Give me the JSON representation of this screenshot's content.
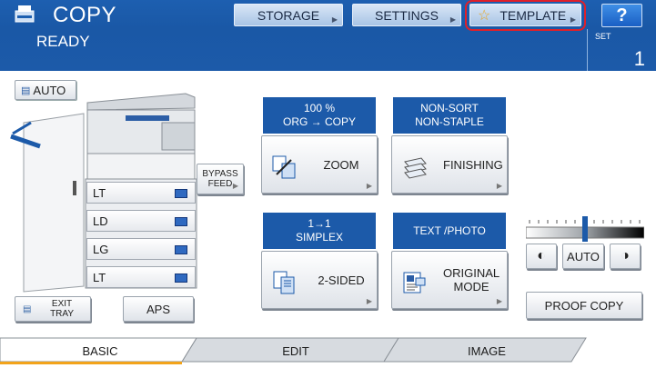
{
  "header": {
    "title": "COPY",
    "status": "READY",
    "buttons": {
      "storage": "STORAGE",
      "settings": "SETTINGS",
      "template": "TEMPLATE",
      "help": "?"
    },
    "set": {
      "label": "SET",
      "value": "1"
    },
    "icons": {
      "app": "copier-icon",
      "template": "star-icon"
    }
  },
  "left": {
    "auto_label": "AUTO",
    "trays": [
      "LT",
      "LD",
      "LG",
      "LT"
    ],
    "bypass_feed": [
      "BYPASS",
      "FEED"
    ],
    "exit_tray": [
      "EXIT",
      "TRAY"
    ],
    "aps": "APS"
  },
  "functions": {
    "zoom": {
      "header": [
        "100 %",
        "ORG → COPY"
      ],
      "label": "ZOOM",
      "icon": "zoom-icon"
    },
    "finishing": {
      "header": [
        "NON-SORT",
        "NON-STAPLE"
      ],
      "label": "FINISHING",
      "icon": "finishing-icon"
    },
    "two_sided": {
      "header": [
        "1→1",
        "SIMPLEX"
      ],
      "label": "2-SIDED",
      "icon": "duplex-icon"
    },
    "original_mode": {
      "header": [
        "TEXT /PHOTO"
      ],
      "label": [
        "ORIGINAL",
        "MODE"
      ],
      "icon": "original-mode-icon"
    }
  },
  "density": {
    "auto_label": "AUTO",
    "level_fraction": 0.5
  },
  "proof_copy": "PROOF COPY",
  "tabs": [
    "BASIC",
    "EDIT",
    "IMAGE"
  ],
  "colors": {
    "header_blue": "#1c5aa9",
    "highlight_red": "#e0202a",
    "tab_accent": "#f2a31a"
  }
}
